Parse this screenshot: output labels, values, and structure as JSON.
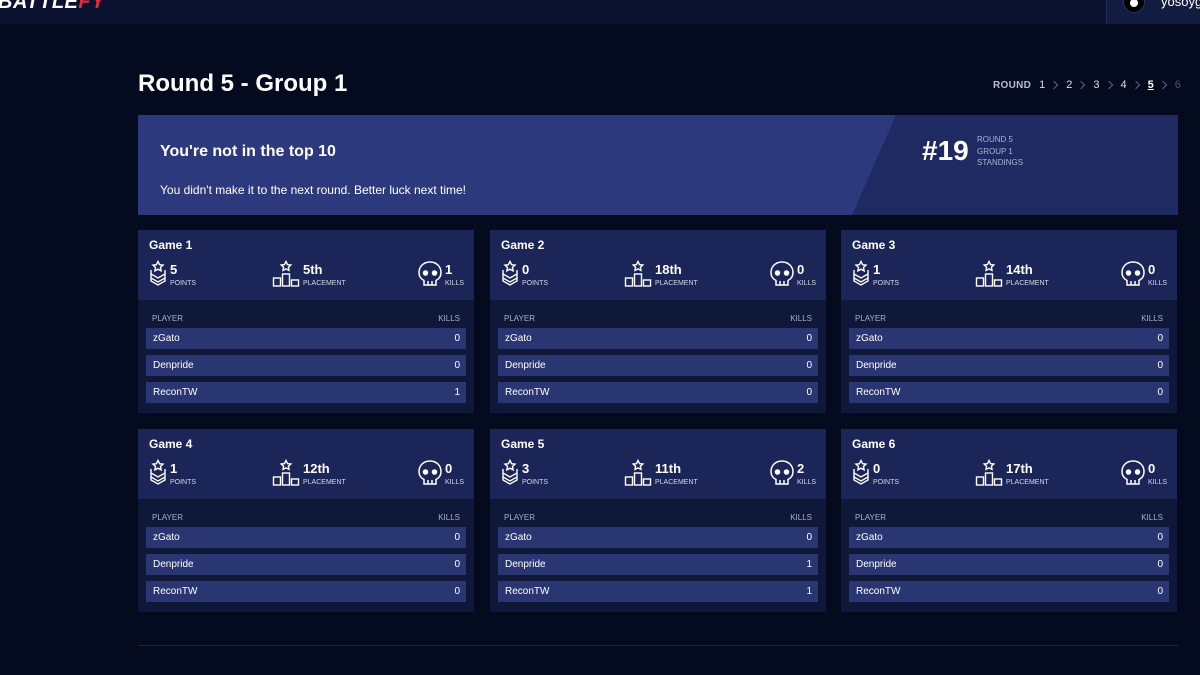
{
  "header": {
    "logo_main": "BATTLE",
    "logo_accent": "FY",
    "username": "yosoyga"
  },
  "page": {
    "title": "Round 5 - Group 1"
  },
  "round_nav": {
    "label": "ROUND",
    "rounds": [
      "1",
      "2",
      "3",
      "4",
      "5",
      "6"
    ],
    "active": "5"
  },
  "banner": {
    "title": "You're not in the top 10",
    "text": "You didn't make it to the next round. Better luck next time!",
    "rank": "#19",
    "meta_round": "ROUND 5",
    "meta_group": "GROUP 1",
    "meta_standings": "STANDINGS"
  },
  "labels": {
    "points": "POINTS",
    "placement": "PLACEMENT",
    "kills": "KILLS",
    "player": "PLAYER",
    "kills_col": "KILLS"
  },
  "games": [
    {
      "title": "Game 1",
      "points": "5",
      "placement": "5th",
      "kills": "1",
      "players": [
        {
          "name": "zGato",
          "kills": "0"
        },
        {
          "name": "Denpride",
          "kills": "0"
        },
        {
          "name": "ReconTW",
          "kills": "1"
        }
      ]
    },
    {
      "title": "Game 2",
      "points": "0",
      "placement": "18th",
      "kills": "0",
      "players": [
        {
          "name": "zGato",
          "kills": "0"
        },
        {
          "name": "Denpride",
          "kills": "0"
        },
        {
          "name": "ReconTW",
          "kills": "0"
        }
      ]
    },
    {
      "title": "Game 3",
      "points": "1",
      "placement": "14th",
      "kills": "0",
      "players": [
        {
          "name": "zGato",
          "kills": "0"
        },
        {
          "name": "Denpride",
          "kills": "0"
        },
        {
          "name": "ReconTW",
          "kills": "0"
        }
      ]
    },
    {
      "title": "Game 4",
      "points": "1",
      "placement": "12th",
      "kills": "0",
      "players": [
        {
          "name": "zGato",
          "kills": "0"
        },
        {
          "name": "Denpride",
          "kills": "0"
        },
        {
          "name": "ReconTW",
          "kills": "0"
        }
      ]
    },
    {
      "title": "Game 5",
      "points": "3",
      "placement": "11th",
      "kills": "2",
      "players": [
        {
          "name": "zGato",
          "kills": "0"
        },
        {
          "name": "Denpride",
          "kills": "1"
        },
        {
          "name": "ReconTW",
          "kills": "1"
        }
      ]
    },
    {
      "title": "Game 6",
      "points": "0",
      "placement": "17th",
      "kills": "0",
      "players": [
        {
          "name": "zGato",
          "kills": "0"
        },
        {
          "name": "Denpride",
          "kills": "0"
        },
        {
          "name": "ReconTW",
          "kills": "0"
        }
      ]
    }
  ]
}
